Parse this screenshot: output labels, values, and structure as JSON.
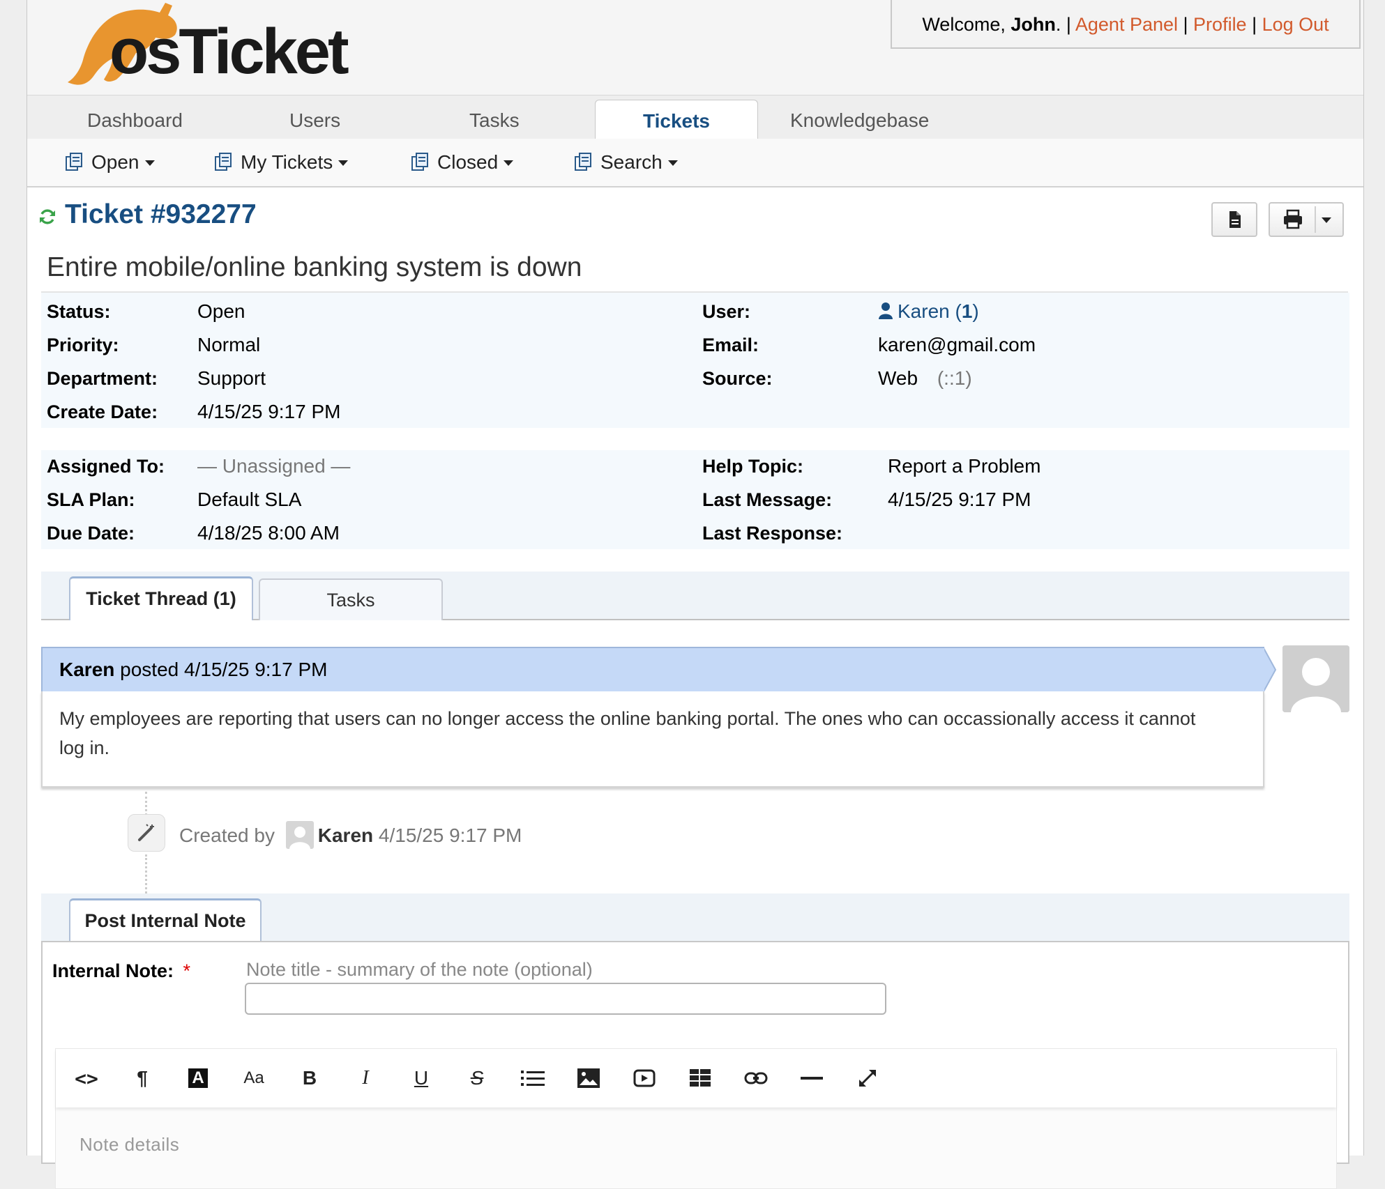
{
  "header": {
    "logo_text": "osTicket",
    "welcome_prefix": "Welcome, ",
    "user_name": "John",
    "welcome_suffix": ". | ",
    "agent_panel": "Agent Panel",
    "profile": "Profile",
    "logout": "Log Out",
    "sep": " | "
  },
  "nav": {
    "tabs": [
      {
        "label": "Dashboard"
      },
      {
        "label": "Users"
      },
      {
        "label": "Tasks"
      },
      {
        "label": "Tickets",
        "active": true
      },
      {
        "label": "Knowledgebase"
      }
    ]
  },
  "subnav": {
    "items": [
      {
        "label": "Open"
      },
      {
        "label": "My Tickets"
      },
      {
        "label": "Closed"
      },
      {
        "label": "Search"
      }
    ]
  },
  "ticket": {
    "title": "Ticket #932277",
    "subject": "Entire mobile/online banking system is down",
    "info1": {
      "status_label": "Status:",
      "status": "Open",
      "priority_label": "Priority:",
      "priority": "Normal",
      "department_label": "Department:",
      "department": "Support",
      "create_date_label": "Create Date:",
      "create_date": "4/15/25 9:17 PM",
      "user_label": "User:",
      "user": "Karen",
      "user_count_open": " (",
      "user_count": "1",
      "user_count_close": ")",
      "email_label": "Email:",
      "email": "karen@gmail.com",
      "source_label": "Source:",
      "source": "Web",
      "source_ip": "(::1)"
    },
    "info2": {
      "assigned_label": "Assigned To:",
      "assigned": "— Unassigned —",
      "sla_label": "SLA Plan:",
      "sla": "Default SLA",
      "due_label": "Due Date:",
      "due": "4/18/25 8:00 AM",
      "topic_label": "Help Topic:",
      "topic": "Report a Problem",
      "last_message_label": "Last Message:",
      "last_message": "4/15/25 9:17 PM",
      "last_response_label": "Last Response:",
      "last_response": ""
    }
  },
  "thread_tabs": [
    {
      "label": "Ticket Thread (1)",
      "active": true
    },
    {
      "label": "Tasks"
    }
  ],
  "thread_entry": {
    "poster": "Karen",
    "posted_text": " posted 4/15/25 9:17 PM",
    "body": "My employees are reporting that users can no longer access the online banking portal. The ones who can occassionally access it cannot log in."
  },
  "event": {
    "prefix": "Created by",
    "user": "Karen",
    "time": "4/15/25 9:17 PM"
  },
  "note": {
    "tab_label": "Post Internal Note",
    "field_label": "Internal Note:",
    "required_mark": "*",
    "title_placeholder": "Note title - summary of the note (optional)",
    "details_placeholder": "Note details"
  },
  "toolbar_icons": [
    "code-icon",
    "paragraph-icon",
    "font-color-icon",
    "font-size-icon",
    "bold-icon",
    "italic-icon",
    "underline-icon",
    "strikethrough-icon",
    "list-icon",
    "image-icon",
    "video-icon",
    "table-icon",
    "link-icon",
    "horizontal-rule-icon",
    "fullscreen-icon"
  ],
  "toolbar_glyphs": {
    "bold": "B",
    "italic": "I",
    "underline": "U",
    "strike": "S",
    "fontsize": "Aa",
    "paragraph": "¶",
    "code": "<>",
    "fontcolor": "A"
  },
  "colors": {
    "accent_link": "#d25a2c",
    "title_blue": "#184e81",
    "thread_header": "#c5d9f7",
    "info_bg": "#f4f9fd",
    "logo_orange": "#e8952f"
  }
}
